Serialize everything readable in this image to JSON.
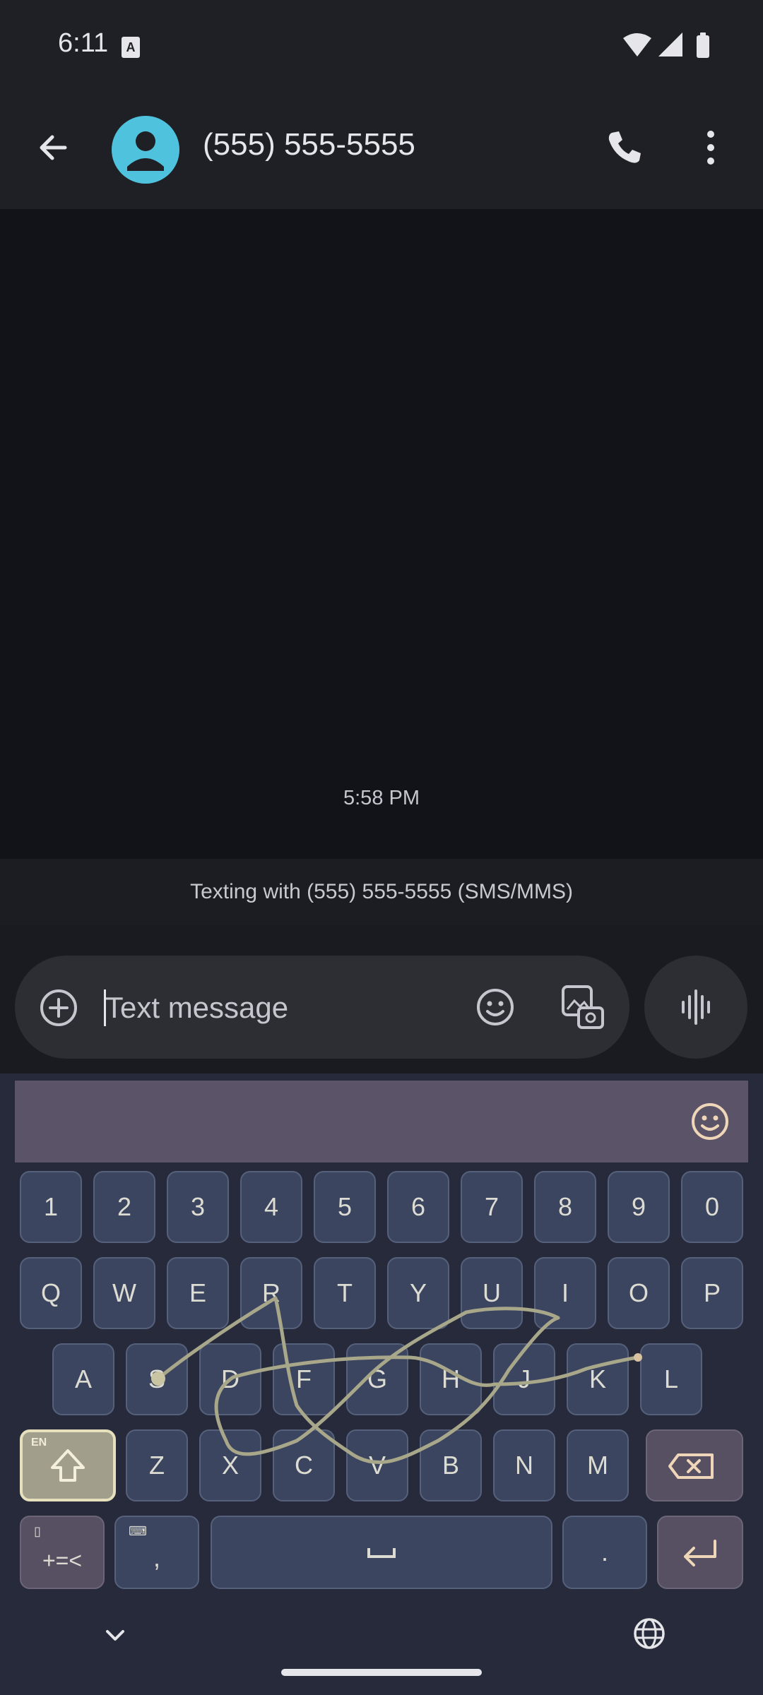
{
  "status_bar": {
    "time": "6:11",
    "icons": [
      "keyboard-a-icon",
      "wifi-icon",
      "signal-icon",
      "battery-icon"
    ]
  },
  "header": {
    "title": "(555) 555-5555",
    "icons": [
      "back-arrow-icon",
      "avatar-person-icon",
      "phone-icon",
      "more-vert-icon"
    ]
  },
  "conversation": {
    "timestamp": "5:58 PM",
    "banner": "Texting with (555) 555-5555 (SMS/MMS)"
  },
  "composer": {
    "placeholder": "Text message",
    "value": "",
    "icons": [
      "add-circle-icon",
      "emoji-icon",
      "gallery-icon",
      "voice-waveform-icon"
    ]
  },
  "keyboard": {
    "number_row": [
      "1",
      "2",
      "3",
      "4",
      "5",
      "6",
      "7",
      "8",
      "9",
      "0"
    ],
    "row1": [
      "Q",
      "W",
      "E",
      "R",
      "T",
      "Y",
      "U",
      "I",
      "O",
      "P"
    ],
    "row2": [
      "A",
      "S",
      "D",
      "F",
      "G",
      "H",
      "J",
      "K",
      "L"
    ],
    "row3": [
      "Z",
      "X",
      "C",
      "V",
      "B",
      "N",
      "M"
    ],
    "shift_lang": "EN",
    "symbols_label": "+=<",
    "comma_label": ",",
    "period_label": ".",
    "swipe_trail_color": "#a8a78a",
    "key_color": "#3b4560",
    "accent_shift_color": "#a29e8c"
  },
  "nav": {
    "icons": [
      "chevron-down-icon",
      "globe-icon"
    ]
  }
}
